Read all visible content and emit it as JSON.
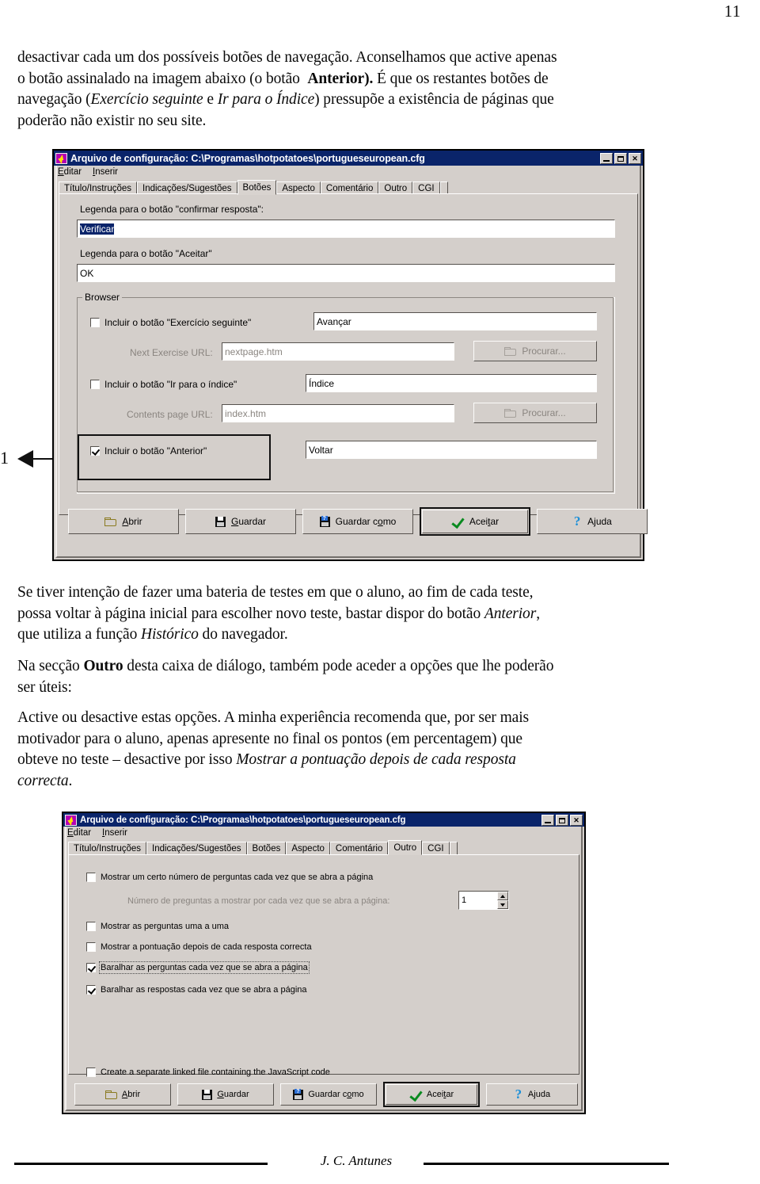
{
  "page": {
    "number": "11",
    "footer_author": "J. C. Antunes"
  },
  "paragraphs": {
    "intro": [
      {
        "t": "desactivar cada um dos possíveis botões de navegação. Aconselhamos que active apenas"
      },
      {
        "t": "o botão assinalado na imagem abaixo (o botão "
      },
      {
        "t": "Anterior).",
        "style": "bold"
      },
      {
        "t": " É que os restantes botões de"
      },
      {
        "t": "navegação ("
      },
      {
        "t": "Exercício seguinte",
        "style": "italic"
      },
      {
        "t": " e "
      },
      {
        "t": "Ir para o Índice",
        "style": "italic"
      },
      {
        "t": ") pressupõe a existência de páginas que"
      },
      {
        "t": "poderão não existir no seu site."
      }
    ],
    "intro_lines": [
      "desactivar cada um dos possíveis botões de navegação. Aconselhamos que active apenas",
      "o botão assinalado na imagem abaixo (o botão  Anterior). É que os restantes botões de",
      "navegação (Exercício seguinte e Ir para o Índice) pressupõe a existência de páginas que",
      "poderão não existir no seu site."
    ],
    "middle_line1": " Se tiver intenção de fazer uma bateria de testes em que o aluno, ao fim de cada teste,",
    "middle_line2_a": "possa voltar à página inicial para escolher novo teste, bastar dispor do botão ",
    "middle_line2_em": "Anterior",
    "middle_line2_b": ",",
    "middle_line3_a": "que utiliza a função ",
    "middle_line3_em": "Histórico",
    "middle_line3_b": " do navegador.",
    "middle2_line1_a": "Na secção ",
    "middle2_line1_strong": "Outro",
    "middle2_line1_b": " desta caixa de diálogo, também pode aceder a opções que lhe poderão",
    "middle2_line2": "ser úteis:",
    "last_line1": "Active ou desactive estas opções. A minha experiência recomenda que, por ser mais",
    "last_line2": "motivador para o aluno, apenas apresente no final os pontos (em percentagem) que",
    "last_line3_a": "obteve no teste – desactive por isso ",
    "last_line3_em": "Mostrar a pontuação depois de cada resposta",
    "last_line4_em": "correcta",
    "last_line4_b": "."
  },
  "annotation": {
    "number": "1"
  },
  "dialog1": {
    "title": "Arquivo de configuração: C:\\Programas\\hotpotatoes\\portugueseuropean.cfg",
    "titlebar_icon": "hotpotatoes-icon",
    "window_buttons": {
      "minimize": "_",
      "maximize": "□",
      "close": "✕"
    },
    "menu": [
      {
        "underline": "E",
        "rest": "ditar"
      },
      {
        "underline": "I",
        "rest": "nserir"
      }
    ],
    "tabs": [
      {
        "label": "Título/Instruções",
        "active": false
      },
      {
        "label": "Indicações/Sugestões",
        "active": false
      },
      {
        "label": "Botões",
        "active": true
      },
      {
        "label": "Aspecto",
        "active": false
      },
      {
        "label": "Comentário",
        "active": false
      },
      {
        "label": "Outro",
        "active": false
      },
      {
        "label": "CGI",
        "active": false
      }
    ],
    "fields": {
      "check_caption_label": "Legenda para o botão \"confirmar resposta\":",
      "check_caption_value": "Verificar",
      "accept_caption_label": "Legenda para o botão \"Aceitar\"",
      "accept_caption_value": "OK"
    },
    "browser_group": {
      "title": "Browser",
      "next_exercise_checkbox": "Incluir o botão \"Exercício seguinte\"",
      "next_exercise_checked": false,
      "next_exercise_caption": "Avançar",
      "next_url_label": "Next Exercise URL:",
      "next_url_value": "nextpage.htm",
      "next_browse_button": "Procurar...",
      "contents_checkbox": "Incluir o botão  \"Ir para o índice\"",
      "contents_checked": false,
      "contents_caption": "Índice",
      "contents_url_label": "Contents page URL:",
      "contents_url_value": "index.htm",
      "contents_browse_button": "Procurar...",
      "back_checkbox": "Incluir o botão \"Anterior\"",
      "back_checked": true,
      "back_caption": "Voltar"
    },
    "buttons": [
      {
        "label_pre": "",
        "label_u": "A",
        "label_post": "brir",
        "icon": "folder-open-icon",
        "default": false
      },
      {
        "label_pre": "",
        "label_u": "G",
        "label_post": "uardar",
        "icon": "floppy-disk-icon",
        "default": false
      },
      {
        "label_pre": "Guardar c",
        "label_u": "o",
        "label_post": "mo",
        "icon": "floppy-disk-question-icon",
        "default": false
      },
      {
        "label_pre": "Acei",
        "label_u": "t",
        "label_post": "ar",
        "icon": "green-check-icon",
        "default": true
      },
      {
        "label_pre": "A",
        "label_u": "j",
        "label_post": "uda",
        "icon": "question-mark-icon",
        "default": false
      }
    ]
  },
  "dialog2": {
    "title": "Arquivo de configuração: C:\\Programas\\hotpotatoes\\portugueseuropean.cfg",
    "titlebar_icon": "hotpotatoes-icon",
    "window_buttons": {
      "minimize": "_",
      "maximize": "□",
      "close": "✕"
    },
    "menu": [
      {
        "underline": "E",
        "rest": "ditar"
      },
      {
        "underline": "I",
        "rest": "nserir"
      }
    ],
    "tabs": [
      {
        "label": "Título/Instruções",
        "active": false
      },
      {
        "label": "Indicações/Sugestões",
        "active": false
      },
      {
        "label": "Botões",
        "active": false
      },
      {
        "label": "Aspecto",
        "active": false
      },
      {
        "label": "Comentário",
        "active": false
      },
      {
        "label": "Outro",
        "active": true
      },
      {
        "label": "CGI",
        "active": false
      }
    ],
    "options": [
      {
        "label": "Mostrar um certo número de perguntas cada vez que se abra a página",
        "checked": false,
        "focused": false
      },
      {
        "label": "Mostrar as perguntas uma a uma",
        "checked": false,
        "focused": false
      },
      {
        "label": "Mostrar a pontuação depois de cada resposta correcta",
        "checked": false,
        "focused": false
      },
      {
        "label": "Baralhar as perguntas cada vez que se abra a página",
        "checked": true,
        "focused": true
      },
      {
        "label": "Baralhar as respostas cada vez que se abra a página",
        "checked": true,
        "focused": false
      }
    ],
    "number_row": {
      "label": "Número de preguntas a mostrar por cada vez que se abra a página:",
      "value": "1",
      "disabled": true
    },
    "javascript_option": {
      "label": "Create a separate linked file containing the JavaScript code",
      "checked": false
    },
    "buttons": [
      {
        "label_pre": "",
        "label_u": "A",
        "label_post": "brir",
        "icon": "folder-open-icon",
        "default": false
      },
      {
        "label_pre": "",
        "label_u": "G",
        "label_post": "uardar",
        "icon": "floppy-disk-icon",
        "default": false
      },
      {
        "label_pre": "Guardar c",
        "label_u": "o",
        "label_post": "mo",
        "icon": "floppy-disk-question-icon",
        "default": false
      },
      {
        "label_pre": "Acei",
        "label_u": "t",
        "label_post": "ar",
        "icon": "green-check-icon",
        "default": true
      },
      {
        "label_pre": "A",
        "label_u": "j",
        "label_post": "uda",
        "icon": "question-mark-icon",
        "default": false
      }
    ]
  }
}
